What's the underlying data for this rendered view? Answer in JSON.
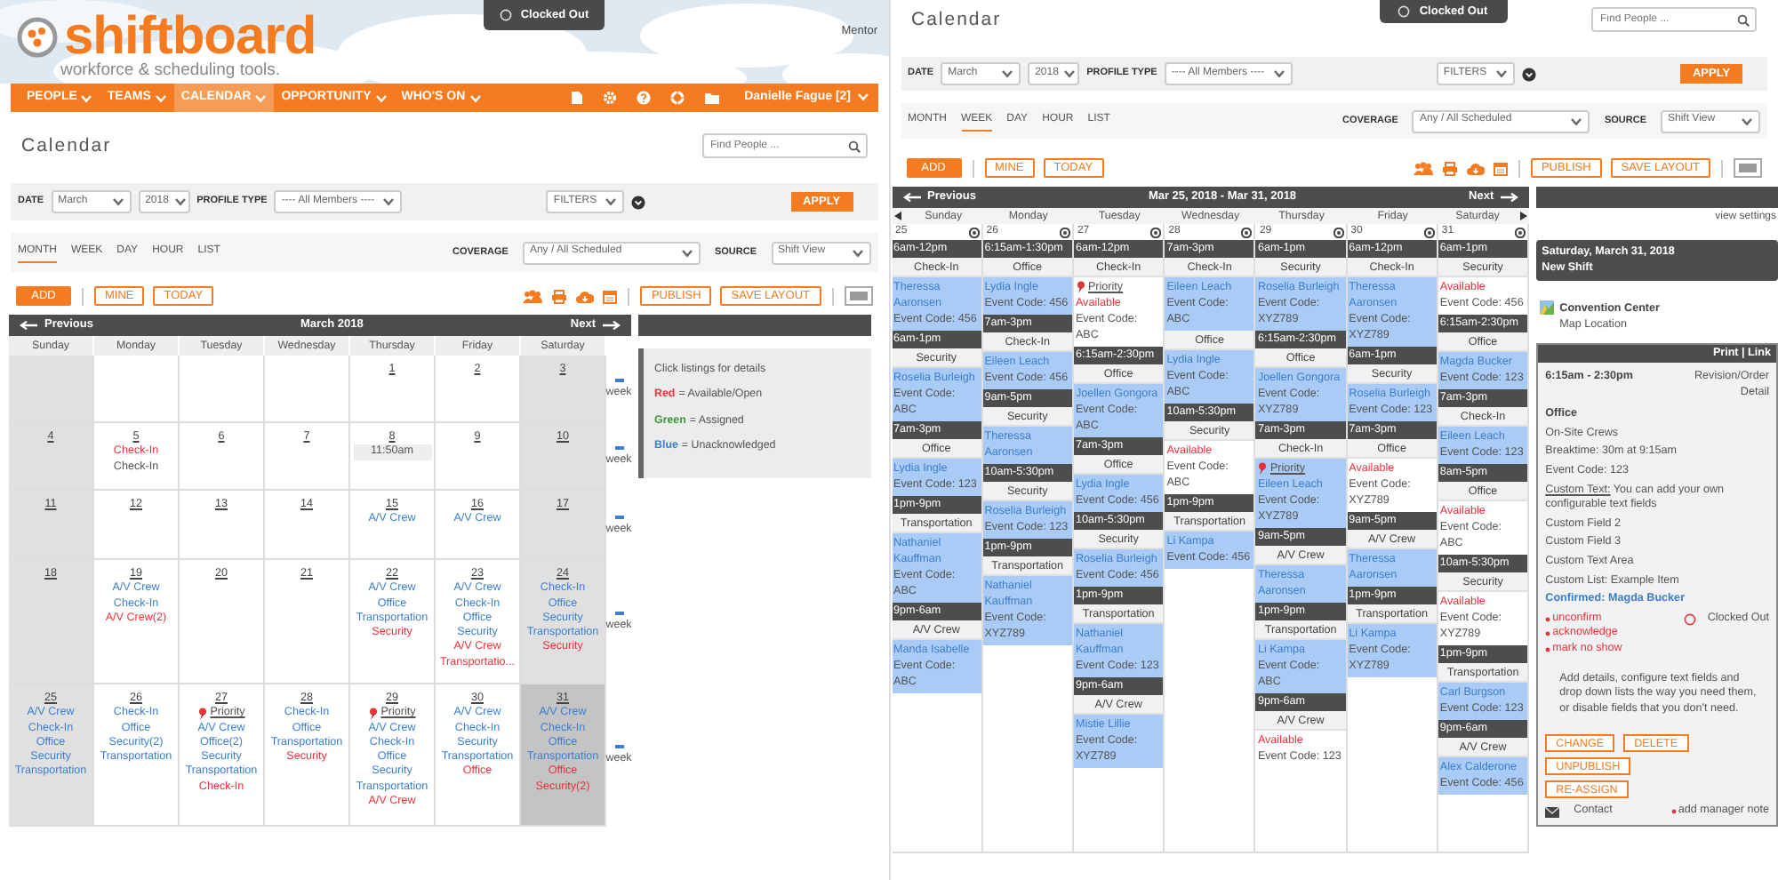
{
  "left": {
    "toast": {
      "text": "Clocked Out"
    },
    "brand": {
      "name": "shiftboard",
      "tagline": "workforce & scheduling tools.",
      "role": "Mentor",
      "nav": [
        {
          "label": "PEOPLE",
          "selected": false
        },
        {
          "label": "TEAMS",
          "selected": false
        },
        {
          "label": "CALENDAR",
          "selected": true
        },
        {
          "label": "OPPORTUNITY",
          "selected": false
        },
        {
          "label": "WHO'S ON",
          "selected": false
        }
      ],
      "user": "Danielle Fague [2]"
    },
    "toolbar": {
      "title": "Calendar",
      "search": {
        "placeholder": "Find People ..."
      },
      "date_label": "DATE",
      "month": "March",
      "year": "2018",
      "profile_label": "PROFILE TYPE",
      "profile": "---- All Members ----",
      "filters": "FILTERS",
      "apply": "APPLY",
      "views": [
        {
          "label": "MONTH",
          "selected": true
        },
        {
          "label": "WEEK",
          "selected": false
        },
        {
          "label": "DAY",
          "selected": false
        },
        {
          "label": "HOUR",
          "selected": false
        },
        {
          "label": "LIST",
          "selected": false
        }
      ],
      "coverage_label": "COVERAGE",
      "coverage": "Any / All Scheduled",
      "source_label": "SOURCE",
      "source": "Shift View",
      "buttons": [
        {
          "label": "ADD",
          "kind": "primary"
        },
        {
          "label": "MINE",
          "kind": "outline"
        },
        {
          "label": "TODAY",
          "kind": "outline"
        }
      ],
      "right_buttons": [
        {
          "label": "PUBLISH",
          "kind": "outline"
        },
        {
          "label": "SAVE LAYOUT",
          "kind": "outline"
        }
      ]
    },
    "month": {
      "previous": "Previous",
      "title": "March 2018",
      "next": "Next",
      "weekdays": [
        "Sunday",
        "Monday",
        "Tuesday",
        "Wednesday",
        "Thursday",
        "Friday",
        "Saturday"
      ],
      "weeks": [
        {
          "week_link": "week",
          "days": [
            {
              "weekend": true,
              "selected": false
            },
            {
              "weekend": false,
              "selected": false
            },
            {
              "weekend": false,
              "selected": false
            },
            {
              "weekend": false,
              "selected": false
            },
            {
              "date": "1",
              "weekend": false,
              "selected": false
            },
            {
              "date": "2",
              "weekend": false,
              "selected": false
            },
            {
              "date": "3",
              "weekend": true,
              "selected": false
            }
          ]
        },
        {
          "week_link": "week",
          "days": [
            {
              "date": "4",
              "weekend": true,
              "selected": false
            },
            {
              "date": "5",
              "weekend": false,
              "selected": false,
              "entries": [
                {
                  "kind": "listing",
                  "text": "Check-In",
                  "color": "#e8333c"
                },
                {
                  "kind": "listing",
                  "text": "Check-In",
                  "color": "#555555"
                }
              ]
            },
            {
              "date": "6",
              "weekend": false,
              "selected": false
            },
            {
              "date": "7",
              "weekend": false,
              "selected": false
            },
            {
              "date": "8",
              "weekend": false,
              "selected": false,
              "entries": [
                {
                  "kind": "time",
                  "text": "11:50am"
                }
              ]
            },
            {
              "date": "9",
              "weekend": false,
              "selected": false
            },
            {
              "date": "10",
              "weekend": true,
              "selected": false
            }
          ]
        },
        {
          "week_link": "week",
          "days": [
            {
              "date": "11",
              "weekend": true,
              "selected": false
            },
            {
              "date": "12",
              "weekend": false,
              "selected": false
            },
            {
              "date": "13",
              "weekend": false,
              "selected": false
            },
            {
              "date": "14",
              "weekend": false,
              "selected": false
            },
            {
              "date": "15",
              "weekend": false,
              "selected": false,
              "entries": [
                {
                  "kind": "listing",
                  "text": "A/V Crew",
                  "color": "#3d7fcc"
                }
              ]
            },
            {
              "date": "16",
              "weekend": false,
              "selected": false,
              "entries": [
                {
                  "kind": "listing",
                  "text": "A/V Crew",
                  "color": "#3d7fcc"
                }
              ]
            },
            {
              "date": "17",
              "weekend": true,
              "selected": false
            }
          ]
        },
        {
          "week_link": "week",
          "days": [
            {
              "date": "18",
              "weekend": true,
              "selected": false
            },
            {
              "date": "19",
              "weekend": false,
              "selected": false,
              "entries": [
                {
                  "kind": "listing",
                  "text": "A/V Crew",
                  "color": "#3d7fcc"
                },
                {
                  "kind": "listing",
                  "text": "Check-In",
                  "color": "#3d7fcc"
                },
                {
                  "kind": "listing",
                  "text": "A/V Crew(2)",
                  "color": "#e8333c"
                }
              ]
            },
            {
              "date": "20",
              "weekend": false,
              "selected": false
            },
            {
              "date": "21",
              "weekend": false,
              "selected": false
            },
            {
              "date": "22",
              "weekend": false,
              "selected": false,
              "entries": [
                {
                  "kind": "listing",
                  "text": "A/V Crew",
                  "color": "#3d7fcc"
                },
                {
                  "kind": "listing",
                  "text": "Office",
                  "color": "#3d7fcc"
                },
                {
                  "kind": "listing",
                  "text": "Transportation",
                  "color": "#3d7fcc"
                },
                {
                  "kind": "listing",
                  "text": "Security",
                  "color": "#e8333c"
                }
              ]
            },
            {
              "date": "23",
              "weekend": false,
              "selected": false,
              "entries": [
                {
                  "kind": "listing",
                  "text": "A/V Crew",
                  "color": "#3d7fcc"
                },
                {
                  "kind": "listing",
                  "text": "Check-In",
                  "color": "#3d7fcc"
                },
                {
                  "kind": "listing",
                  "text": "Office",
                  "color": "#3d7fcc"
                },
                {
                  "kind": "listing",
                  "text": "Security",
                  "color": "#3d7fcc"
                },
                {
                  "kind": "listing",
                  "text": "A/V Crew",
                  "color": "#e8333c"
                },
                {
                  "kind": "listing",
                  "text": "Transportatio...",
                  "color": "#e8333c"
                }
              ]
            },
            {
              "date": "24",
              "weekend": true,
              "selected": false,
              "entries": [
                {
                  "kind": "listing",
                  "text": "Check-In",
                  "color": "#3d7fcc"
                },
                {
                  "kind": "listing",
                  "text": "Office",
                  "color": "#3d7fcc"
                },
                {
                  "kind": "listing",
                  "text": "Security",
                  "color": "#3d7fcc"
                },
                {
                  "kind": "listing",
                  "text": "Transportation",
                  "color": "#3d7fcc"
                },
                {
                  "kind": "listing",
                  "text": "Security",
                  "color": "#e8333c"
                }
              ]
            }
          ]
        },
        {
          "week_link": "week",
          "days": [
            {
              "date": "25",
              "weekend": true,
              "selected": false,
              "entries": [
                {
                  "kind": "listing",
                  "text": "A/V Crew",
                  "color": "#3d7fcc"
                },
                {
                  "kind": "listing",
                  "text": "Check-In",
                  "color": "#3d7fcc"
                },
                {
                  "kind": "listing",
                  "text": "Office",
                  "color": "#3d7fcc"
                },
                {
                  "kind": "listing",
                  "text": "Security",
                  "color": "#3d7fcc"
                },
                {
                  "kind": "listing",
                  "text": "Transportation",
                  "color": "#3d7fcc"
                }
              ]
            },
            {
              "date": "26",
              "weekend": false,
              "selected": false,
              "entries": [
                {
                  "kind": "listing",
                  "text": "Check-In",
                  "color": "#3d7fcc"
                },
                {
                  "kind": "listing",
                  "text": "Office",
                  "color": "#3d7fcc"
                },
                {
                  "kind": "listing",
                  "text": "Security(2)",
                  "color": "#3d7fcc"
                },
                {
                  "kind": "listing",
                  "text": "Transportation",
                  "color": "#3d7fcc"
                }
              ]
            },
            {
              "date": "27",
              "weekend": false,
              "selected": false,
              "entries": [
                {
                  "kind": "priority",
                  "text": "Priority"
                },
                {
                  "kind": "listing",
                  "text": "A/V Crew",
                  "color": "#3d7fcc"
                },
                {
                  "kind": "listing",
                  "text": "Office(2)",
                  "color": "#3d7fcc"
                },
                {
                  "kind": "listing",
                  "text": "Security",
                  "color": "#3d7fcc"
                },
                {
                  "kind": "listing",
                  "text": "Transportation",
                  "color": "#3d7fcc"
                },
                {
                  "kind": "listing",
                  "text": "Check-In",
                  "color": "#e8333c"
                }
              ]
            },
            {
              "date": "28",
              "weekend": false,
              "selected": false,
              "entries": [
                {
                  "kind": "listing",
                  "text": "Check-In",
                  "color": "#3d7fcc"
                },
                {
                  "kind": "listing",
                  "text": "Office",
                  "color": "#3d7fcc"
                },
                {
                  "kind": "listing",
                  "text": "Transportation",
                  "color": "#3d7fcc"
                },
                {
                  "kind": "listing",
                  "text": "Security",
                  "color": "#e8333c"
                }
              ]
            },
            {
              "date": "29",
              "weekend": false,
              "selected": false,
              "entries": [
                {
                  "kind": "priority",
                  "text": "Priority"
                },
                {
                  "kind": "listing",
                  "text": "A/V Crew",
                  "color": "#3d7fcc"
                },
                {
                  "kind": "listing",
                  "text": "Check-In",
                  "color": "#3d7fcc"
                },
                {
                  "kind": "listing",
                  "text": "Office",
                  "color": "#3d7fcc"
                },
                {
                  "kind": "listing",
                  "text": "Security",
                  "color": "#3d7fcc"
                },
                {
                  "kind": "listing",
                  "text": "Transportation",
                  "color": "#3d7fcc"
                },
                {
                  "kind": "listing",
                  "text": "A/V Crew",
                  "color": "#e8333c"
                }
              ]
            },
            {
              "date": "30",
              "weekend": false,
              "selected": false,
              "entries": [
                {
                  "kind": "listing",
                  "text": "A/V Crew",
                  "color": "#3d7fcc"
                },
                {
                  "kind": "listing",
                  "text": "Check-In",
                  "color": "#3d7fcc"
                },
                {
                  "kind": "listing",
                  "text": "Security",
                  "color": "#3d7fcc"
                },
                {
                  "kind": "listing",
                  "text": "Transportation",
                  "color": "#3d7fcc"
                },
                {
                  "kind": "listing",
                  "text": "Office",
                  "color": "#e8333c"
                }
              ]
            },
            {
              "date": "31",
              "weekend": true,
              "selected": true,
              "entries": [
                {
                  "kind": "listing",
                  "text": "A/V Crew",
                  "color": "#3d7fcc"
                },
                {
                  "kind": "listing",
                  "text": "Check-In",
                  "color": "#3d7fcc"
                },
                {
                  "kind": "listing",
                  "text": "Office",
                  "color": "#3d7fcc"
                },
                {
                  "kind": "listing",
                  "text": "Transportation",
                  "color": "#3d7fcc"
                },
                {
                  "kind": "listing",
                  "text": "Office",
                  "color": "#e8333c"
                },
                {
                  "kind": "listing",
                  "text": "Security(2)",
                  "color": "#e8333c"
                }
              ]
            }
          ]
        }
      ]
    },
    "legend": {
      "title": "Click listings for details",
      "items": [
        {
          "key": "Red",
          "text": "= Available/Open",
          "color": "#e8333c"
        },
        {
          "key": "Green",
          "text": "= Assigned",
          "color": "#3a9a3a"
        },
        {
          "key": "Blue",
          "text": "= Unacknowledged",
          "color": "#3d7fcc"
        }
      ]
    }
  },
  "right": {
    "toast": {
      "text": "Clocked Out"
    },
    "toolbar": {
      "title": "Calendar",
      "search": {
        "placeholder": "Find People ..."
      },
      "date_label": "DATE",
      "month": "March",
      "year": "2018",
      "profile_label": "PROFILE TYPE",
      "profile": "---- All Members ----",
      "filters": "FILTERS",
      "apply": "APPLY",
      "views": [
        {
          "label": "MONTH",
          "selected": false
        },
        {
          "label": "WEEK",
          "selected": true
        },
        {
          "label": "DAY",
          "selected": false
        },
        {
          "label": "HOUR",
          "selected": false
        },
        {
          "label": "LIST",
          "selected": false
        }
      ],
      "coverage_label": "COVERAGE",
      "coverage": "Any / All Scheduled",
      "source_label": "SOURCE",
      "source": "Shift View",
      "buttons": [
        {
          "label": "ADD",
          "kind": "primary"
        },
        {
          "label": "MINE",
          "kind": "outline"
        },
        {
          "label": "TODAY",
          "kind": "outline"
        }
      ],
      "right_buttons": [
        {
          "label": "PUBLISH",
          "kind": "outline"
        },
        {
          "label": "SAVE LAYOUT",
          "kind": "outline"
        }
      ]
    },
    "week": {
      "previous": "Previous",
      "title": "Mar 25, 2018 - Mar 31, 2018",
      "next": "Next",
      "days": [
        {
          "name": "Sunday",
          "date": "25",
          "shifts": [
            {
              "time": "6am-12pm",
              "role": "Check-In",
              "entries": [
                {
                  "kind": "assigned",
                  "name": "Theressa Aaronsen",
                  "code": "Event Code: 456"
                }
              ]
            },
            {
              "time": "6am-1pm",
              "role": "Security",
              "entries": [
                {
                  "kind": "assigned",
                  "name": "Roselia Burleigh",
                  "code": "Event Code: ABC"
                }
              ]
            },
            {
              "time": "7am-3pm",
              "role": "Office",
              "entries": [
                {
                  "kind": "assigned",
                  "name": "Lydia Ingle",
                  "code": "Event Code: 123"
                }
              ]
            },
            {
              "time": "1pm-9pm",
              "role": "Transportation",
              "entries": [
                {
                  "kind": "assigned",
                  "name": "Nathaniel Kauffman",
                  "code": "Event Code: ABC"
                }
              ]
            },
            {
              "time": "9pm-6am",
              "role": "A/V Crew",
              "entries": [
                {
                  "kind": "assigned",
                  "name": "Manda Isabelle",
                  "code": "Event Code: ABC"
                }
              ]
            }
          ]
        },
        {
          "name": "Monday",
          "date": "26",
          "shifts": [
            {
              "time": "6:15am-1:30pm",
              "role": "Office",
              "entries": [
                {
                  "kind": "assigned",
                  "name": "Lydia Ingle",
                  "code": "Event Code: 456"
                }
              ]
            },
            {
              "time": "7am-3pm",
              "role": "Check-In",
              "entries": [
                {
                  "kind": "assigned",
                  "name": "Eileen Leach",
                  "code": "Event Code: 456"
                }
              ]
            },
            {
              "time": "9am-5pm",
              "role": "Security",
              "entries": [
                {
                  "kind": "assigned",
                  "name": "Theressa Aaronsen"
                }
              ]
            },
            {
              "time": "10am-5:30pm",
              "role": "Security",
              "entries": [
                {
                  "kind": "assigned",
                  "name": "Roselia Burleigh",
                  "code": "Event Code: 123"
                }
              ]
            },
            {
              "time": "1pm-9pm",
              "role": "Transportation",
              "entries": [
                {
                  "kind": "assigned",
                  "name": "Nathaniel Kauffman",
                  "code": "Event Code: XYZ789"
                }
              ]
            }
          ]
        },
        {
          "name": "Tuesday",
          "date": "27",
          "shifts": [
            {
              "time": "6am-12pm",
              "role": "Check-In",
              "entries": [
                {
                  "kind": "available",
                  "priority": "Priority",
                  "name": "Available",
                  "code": "Event Code: ABC"
                }
              ]
            },
            {
              "time": "6:15am-2:30pm",
              "role": "Office",
              "entries": [
                {
                  "kind": "assigned",
                  "name": "Joellen Gongora",
                  "code": "Event Code: ABC"
                }
              ]
            },
            {
              "time": "7am-3pm",
              "role": "Office",
              "entries": [
                {
                  "kind": "assigned",
                  "name": "Lydia Ingle",
                  "code": "Event Code: 456"
                }
              ]
            },
            {
              "time": "10am-5:30pm",
              "role": "Security",
              "entries": [
                {
                  "kind": "assigned",
                  "name": "Roselia Burleigh",
                  "code": "Event Code: 456"
                }
              ]
            },
            {
              "time": "1pm-9pm",
              "role": "Transportation",
              "entries": [
                {
                  "kind": "assigned",
                  "name": "Nathaniel Kauffman",
                  "code": "Event Code: 123"
                }
              ]
            },
            {
              "time": "9pm-6am",
              "role": "A/V Crew",
              "entries": [
                {
                  "kind": "assigned",
                  "name": "Mistie Lillie",
                  "code": "Event Code: XYZ789"
                }
              ]
            }
          ]
        },
        {
          "name": "Wednesday",
          "date": "28",
          "shifts": [
            {
              "time": "7am-3pm",
              "role": "Check-In",
              "entries": [
                {
                  "kind": "assigned",
                  "name": "Eileen Leach",
                  "code": "Event Code: ABC"
                }
              ]
            },
            {
              "role": "Office",
              "entries": [
                {
                  "kind": "assigned",
                  "name": "Lydia Ingle",
                  "code": "Event Code: ABC"
                }
              ]
            },
            {
              "time": "10am-5:30pm",
              "role": "Security",
              "entries": [
                {
                  "kind": "available",
                  "name": "Available",
                  "code": "Event Code: ABC"
                }
              ]
            },
            {
              "time": "1pm-9pm",
              "role": "Transportation",
              "entries": [
                {
                  "kind": "assigned",
                  "name": "Li Kampa",
                  "code": "Event Code: 456"
                }
              ]
            }
          ]
        },
        {
          "name": "Thursday",
          "date": "29",
          "shifts": [
            {
              "time": "6am-1pm",
              "role": "Security",
              "entries": [
                {
                  "kind": "assigned",
                  "name": "Roselia Burleigh",
                  "code": "Event Code: XYZ789"
                }
              ]
            },
            {
              "time": "6:15am-2:30pm",
              "role": "Office",
              "entries": [
                {
                  "kind": "assigned",
                  "name": "Joellen Gongora",
                  "code": "Event Code: XYZ789"
                }
              ]
            },
            {
              "time": "7am-3pm",
              "role": "Check-In",
              "entries": [
                {
                  "kind": "assigned",
                  "priority": "Priority",
                  "name": "Eileen Leach",
                  "code": "Event Code: XYZ789"
                }
              ]
            },
            {
              "time": "9am-5pm",
              "role": "A/V Crew",
              "entries": [
                {
                  "kind": "assigned",
                  "name": "Theressa Aaronsen"
                }
              ]
            },
            {
              "time": "1pm-9pm",
              "role": "Transportation",
              "entries": [
                {
                  "kind": "assigned",
                  "name": "Li Kampa",
                  "code": "Event Code: ABC"
                }
              ]
            },
            {
              "time": "9pm-6am",
              "role": "A/V Crew",
              "entries": [
                {
                  "kind": "available",
                  "name": "Available",
                  "code": "Event Code: 123"
                }
              ]
            }
          ]
        },
        {
          "name": "Friday",
          "date": "30",
          "shifts": [
            {
              "time": "6am-12pm",
              "role": "Check-In",
              "entries": [
                {
                  "kind": "assigned",
                  "name": "Theressa Aaronsen",
                  "code": "Event Code: XYZ789"
                }
              ]
            },
            {
              "time": "6am-1pm",
              "role": "Security",
              "entries": [
                {
                  "kind": "assigned",
                  "name": "Roselia Burleigh",
                  "code": "Event Code: 123"
                }
              ]
            },
            {
              "time": "7am-3pm",
              "role": "Office",
              "entries": [
                {
                  "kind": "available",
                  "name": "Available",
                  "code": "Event Code: XYZ789"
                }
              ]
            },
            {
              "time": "9am-5pm",
              "role": "A/V Crew",
              "entries": [
                {
                  "kind": "assigned",
                  "name": "Theressa Aaronsen"
                }
              ]
            },
            {
              "time": "1pm-9pm",
              "role": "Transportation",
              "entries": [
                {
                  "kind": "assigned",
                  "name": "Li Kampa",
                  "code": "Event Code: XYZ789"
                }
              ]
            }
          ]
        },
        {
          "name": "Saturday",
          "date": "31",
          "shifts": [
            {
              "time": "6am-1pm",
              "role": "Security",
              "entries": [
                {
                  "kind": "available",
                  "name": "Available",
                  "code": "Event Code: 456"
                }
              ]
            },
            {
              "time": "6:15am-2:30pm",
              "role": "Office",
              "entries": [
                {
                  "kind": "assigned",
                  "name": "Magda Bucker",
                  "code": "Event Code: 123"
                }
              ]
            },
            {
              "time": "7am-3pm",
              "role": "Check-In",
              "entries": [
                {
                  "kind": "assigned",
                  "name": "Eileen Leach",
                  "code": "Event Code: 123"
                }
              ]
            },
            {
              "time": "8am-5pm",
              "role": "Office",
              "entries": [
                {
                  "kind": "available",
                  "name": "Available",
                  "code": "Event Code: ABC"
                }
              ]
            },
            {
              "time": "10am-5:30pm",
              "role": "Security",
              "entries": [
                {
                  "kind": "available",
                  "name": "Available",
                  "code": "Event Code: XYZ789"
                }
              ]
            },
            {
              "time": "1pm-9pm",
              "role": "Transportation",
              "entries": [
                {
                  "kind": "assigned",
                  "name": "Carl Burgson",
                  "code": "Event Code: 123"
                }
              ]
            },
            {
              "time": "9pm-6am",
              "role": "A/V Crew",
              "entries": [
                {
                  "kind": "assigned",
                  "name": "Alex Calderone",
                  "code": "Event Code: 456"
                }
              ]
            }
          ]
        }
      ]
    },
    "detail": {
      "view_settings": "view settings",
      "date": "Saturday, March 31, 2018",
      "subtitle": "New Shift",
      "location": "Convention Center",
      "map_link": "Map Location",
      "header": "Print | Link",
      "time": "6:15am - 2:30pm",
      "revision": "Revision/Order Detail",
      "lines": [
        {
          "kind": "heading",
          "text": "Office"
        },
        {
          "kind": "text",
          "text": "On-Site Crews"
        },
        {
          "kind": "text",
          "text": "Breaktime: 30m at 9:15am"
        },
        {
          "kind": "text",
          "text": "Event Code: 123"
        },
        {
          "kind": "labeled",
          "label": "Custom Text:",
          "text": "You can add your own configurable text fields"
        },
        {
          "kind": "text",
          "text": "Custom Field 2"
        },
        {
          "kind": "text",
          "text": "Custom Field 3"
        },
        {
          "kind": "text",
          "text": "Custom Text Area"
        },
        {
          "kind": "text",
          "text": "Custom List: Example Item"
        },
        {
          "kind": "confirmed",
          "text": "Confirmed: Magda Bucker"
        }
      ],
      "actions": [
        "unconfirm",
        "acknowledge",
        "mark no show"
      ],
      "status": "Clocked Out",
      "description": "Add details, configure text fields and drop down lists the way you need them, or disable fields that you don't need.",
      "buttons": [
        "CHANGE",
        "DELETE",
        "UNPUBLISH",
        "RE-ASSIGN"
      ],
      "contact": "Contact",
      "note": "add manager note"
    }
  }
}
